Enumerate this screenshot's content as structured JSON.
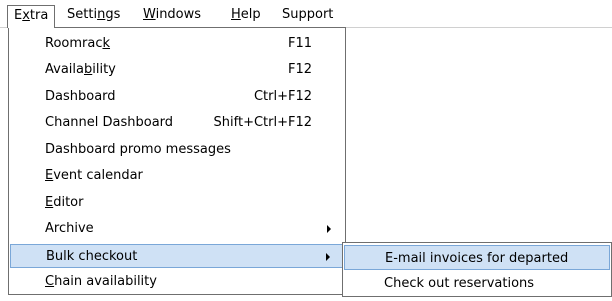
{
  "menubar": {
    "items": [
      {
        "pre": "E",
        "ul": "x",
        "post": "tra"
      },
      {
        "pre": "Setti",
        "ul": "n",
        "post": "gs"
      },
      {
        "pre": "",
        "ul": "W",
        "post": "indows"
      },
      {
        "pre": "",
        "ul": "H",
        "post": "elp"
      },
      {
        "pre": "Support",
        "ul": "",
        "post": ""
      }
    ]
  },
  "extra_menu": {
    "items": [
      {
        "pre": "Roomrac",
        "ul": "k",
        "post": "",
        "accel": "F11"
      },
      {
        "pre": "Availa",
        "ul": "b",
        "post": "ility",
        "accel": "F12"
      },
      {
        "pre": "Dashboard",
        "ul": "",
        "post": "",
        "accel": "Ctrl+F12"
      },
      {
        "pre": "Channel Dashboard",
        "ul": "",
        "post": "",
        "accel": "Shift+Ctrl+F12"
      },
      {
        "pre": "Dashboard promo messages",
        "ul": "",
        "post": "",
        "accel": ""
      },
      {
        "pre": "",
        "ul": "E",
        "post": "vent calendar",
        "accel": ""
      },
      {
        "pre": "",
        "ul": "E",
        "post": "ditor",
        "accel": ""
      },
      {
        "pre": "Archive",
        "ul": "",
        "post": "",
        "accel": ""
      },
      {
        "pre": "Bulk checkout",
        "ul": "",
        "post": "",
        "accel": ""
      },
      {
        "pre": "",
        "ul": "C",
        "post": "hain availability",
        "accel": ""
      }
    ]
  },
  "bulk_checkout_submenu": {
    "items": [
      {
        "label": "E-mail invoices for departed"
      },
      {
        "label": "Check out reservations"
      }
    ]
  },
  "colors": {
    "highlight": "#cfe1f5",
    "highlight_border": "#7aa7d8",
    "menu_border": "#6f6f6f"
  }
}
